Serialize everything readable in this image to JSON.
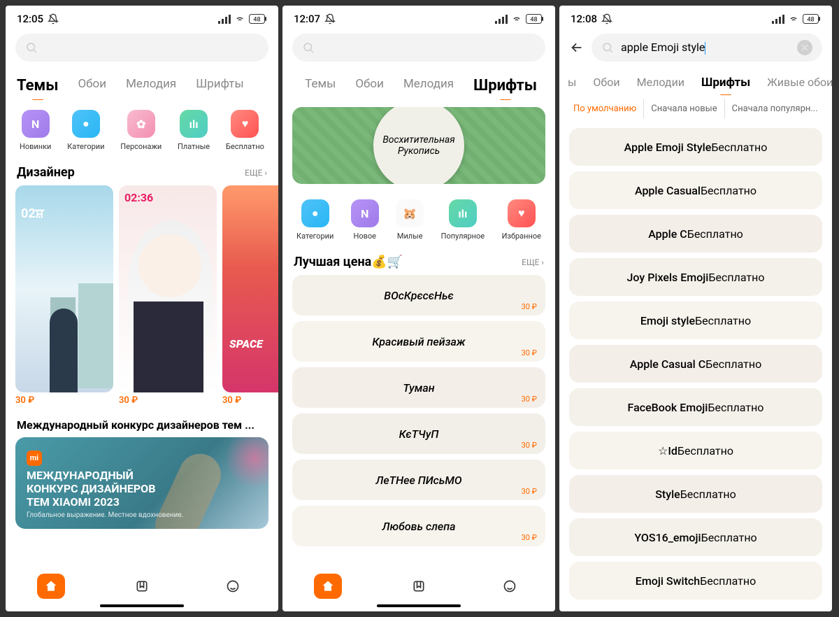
{
  "screen1": {
    "time": "12:05",
    "tabs": [
      "Темы",
      "Обои",
      "Мелодия",
      "Шрифты"
    ],
    "activeTab": 0,
    "icons": [
      {
        "label": "Новинки",
        "cls": "ic-purple",
        "glyph": "N"
      },
      {
        "label": "Категории",
        "cls": "ic-blue",
        "glyph": "●"
      },
      {
        "label": "Персонажи",
        "cls": "ic-pink",
        "glyph": "✿"
      },
      {
        "label": "Платные",
        "cls": "ic-green",
        "glyph": "ılı"
      },
      {
        "label": "Бесплатно",
        "cls": "ic-red",
        "glyph": "♥"
      }
    ],
    "designerTitle": "Дизайнер",
    "more": "ЕЩЕ ›",
    "themes": [
      {
        "price": "30 ₽",
        "cls": "illu1"
      },
      {
        "price": "30 ₽",
        "cls": "illu2"
      },
      {
        "price": "30 ₽",
        "cls": "illu3"
      }
    ],
    "contestSection": "Международный конкурс дизайнеров тем ...",
    "contestLogoText": "mi",
    "contestLine1": "МЕЖДУНАРОДНЫЙ",
    "contestLine2": "КОНКУРС ДИЗАЙНЕРОВ",
    "contestLine3": "ТЕМ XIAOMI 2023",
    "contestSub": "Глобальное выражение. Местное вдохновение."
  },
  "screen2": {
    "time": "12:07",
    "tabs": [
      "Темы",
      "Обои",
      "Мелодия",
      "Шрифты"
    ],
    "activeTab": 3,
    "bannerLine1": "Восхитительная",
    "bannerLine2": "Рукопись",
    "icons": [
      {
        "label": "Категории",
        "cls": "ic-blue",
        "glyph": "●"
      },
      {
        "label": "Новое",
        "cls": "ic-purple",
        "glyph": "N"
      },
      {
        "label": "Милые",
        "cls": "ic-lite",
        "glyph": "🐹"
      },
      {
        "label": "Популярное",
        "cls": "ic-green",
        "glyph": "ılı"
      },
      {
        "label": "Избранное",
        "cls": "ic-red",
        "glyph": "♥"
      }
    ],
    "bestPriceTitle": "Лучшая цена💰🛒",
    "more": "ЕЩЕ ›",
    "fonts": [
      {
        "name": "ВОсКрєсєНьє",
        "price": "30 ₽",
        "bg": "bg1"
      },
      {
        "name": "Красивый пейзаж",
        "price": "30 ₽",
        "bg": "bg2"
      },
      {
        "name": "Туман",
        "price": "30 ₽",
        "bg": "bg3"
      },
      {
        "name": "КєТЧуП",
        "price": "30 ₽",
        "bg": "bg4"
      },
      {
        "name": "ЛеТНее ПИсьМО",
        "price": "30 ₽",
        "bg": "bg1"
      },
      {
        "name": "Любовь слепа",
        "price": "30 ₽",
        "bg": "bg2"
      }
    ]
  },
  "screen3": {
    "time": "12:08",
    "searchValue": "apple Emoji style",
    "tabs": [
      "ы",
      "Обои",
      "Мелодии",
      "Шрифты",
      "Живые обои"
    ],
    "activeTab": 3,
    "filters": [
      "По умолчанию",
      "Сначала новые",
      "Сначала популярн..."
    ],
    "activeFilter": 0,
    "results": [
      {
        "name": "Apple Emoji Style",
        "free": "Бесплатно",
        "bg": "bg1"
      },
      {
        "name": "Apple Casual",
        "free": "Бесплатно",
        "bg": "bg2"
      },
      {
        "name": "Apple C",
        "free": "Бесплатно",
        "bg": "bg3"
      },
      {
        "name": "Joy Pixels Emoji",
        "free": "Бесплатно",
        "bg": "bg1"
      },
      {
        "name": "Emoji style",
        "free": "Бесплатно",
        "bg": "bg2"
      },
      {
        "name": "Apple Casual C",
        "free": "Бесплатно",
        "bg": "bg3"
      },
      {
        "name": "FaceBook Emoji",
        "free": "Бесплатно",
        "bg": "bg1"
      },
      {
        "name": "☆Id",
        "free": "Бесплатно",
        "bg": "bg2"
      },
      {
        "name": "Style",
        "free": "Бесплатно",
        "bg": "bg3"
      },
      {
        "name": "YOS16_emoji",
        "free": "Бесплатно",
        "bg": "bg1"
      },
      {
        "name": "Emoji Switch",
        "free": "Бесплатно",
        "bg": "bg2"
      }
    ]
  },
  "batteryText": "48"
}
